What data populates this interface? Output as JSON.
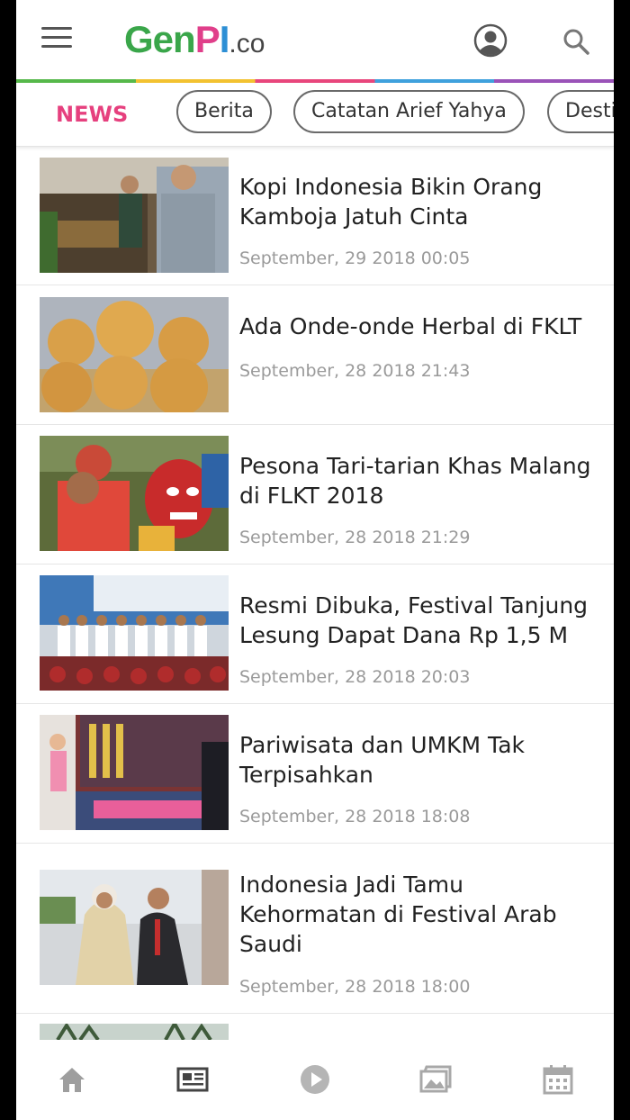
{
  "header": {
    "logo_parts": [
      "G",
      "en",
      "P",
      "I",
      ".co"
    ],
    "menu_icon": "hamburger-menu-icon",
    "account_icon": "user-account-icon",
    "search_icon": "search-icon"
  },
  "tabs": {
    "active": "NEWS",
    "chips": [
      "Berita",
      "Catatan Arief Yahya",
      "Desti"
    ]
  },
  "articles": [
    {
      "title": "Kopi Indonesia Bikin Orang Kamboja Jatuh Cinta",
      "date": "September, 29 2018 00:05"
    },
    {
      "title": "Ada Onde-onde Herbal di FKLT",
      "date": "September, 28 2018 21:43"
    },
    {
      "title": "Pesona Tari-tarian Khas Malang di FLKT 2018",
      "date": "September, 28 2018 21:29"
    },
    {
      "title": "Resmi Dibuka, Festival Tanjung Lesung Dapat Dana Rp 1,5 M",
      "date": "September, 28 2018 20:03"
    },
    {
      "title": "Pariwisata dan UMKM Tak Terpisahkan",
      "date": "September, 28 2018 18:08"
    },
    {
      "title": "Indonesia Jadi Tamu Kehormatan di Festival Arab Saudi",
      "date": "September, 28 2018 18:00"
    }
  ],
  "bottom_nav": [
    "home-icon",
    "news-icon",
    "video-play-icon",
    "gallery-icon",
    "calendar-icon"
  ],
  "colors": {
    "accent": "#e6407e",
    "icon_gray": "#9e9e9e",
    "active_icon": "#555555"
  }
}
